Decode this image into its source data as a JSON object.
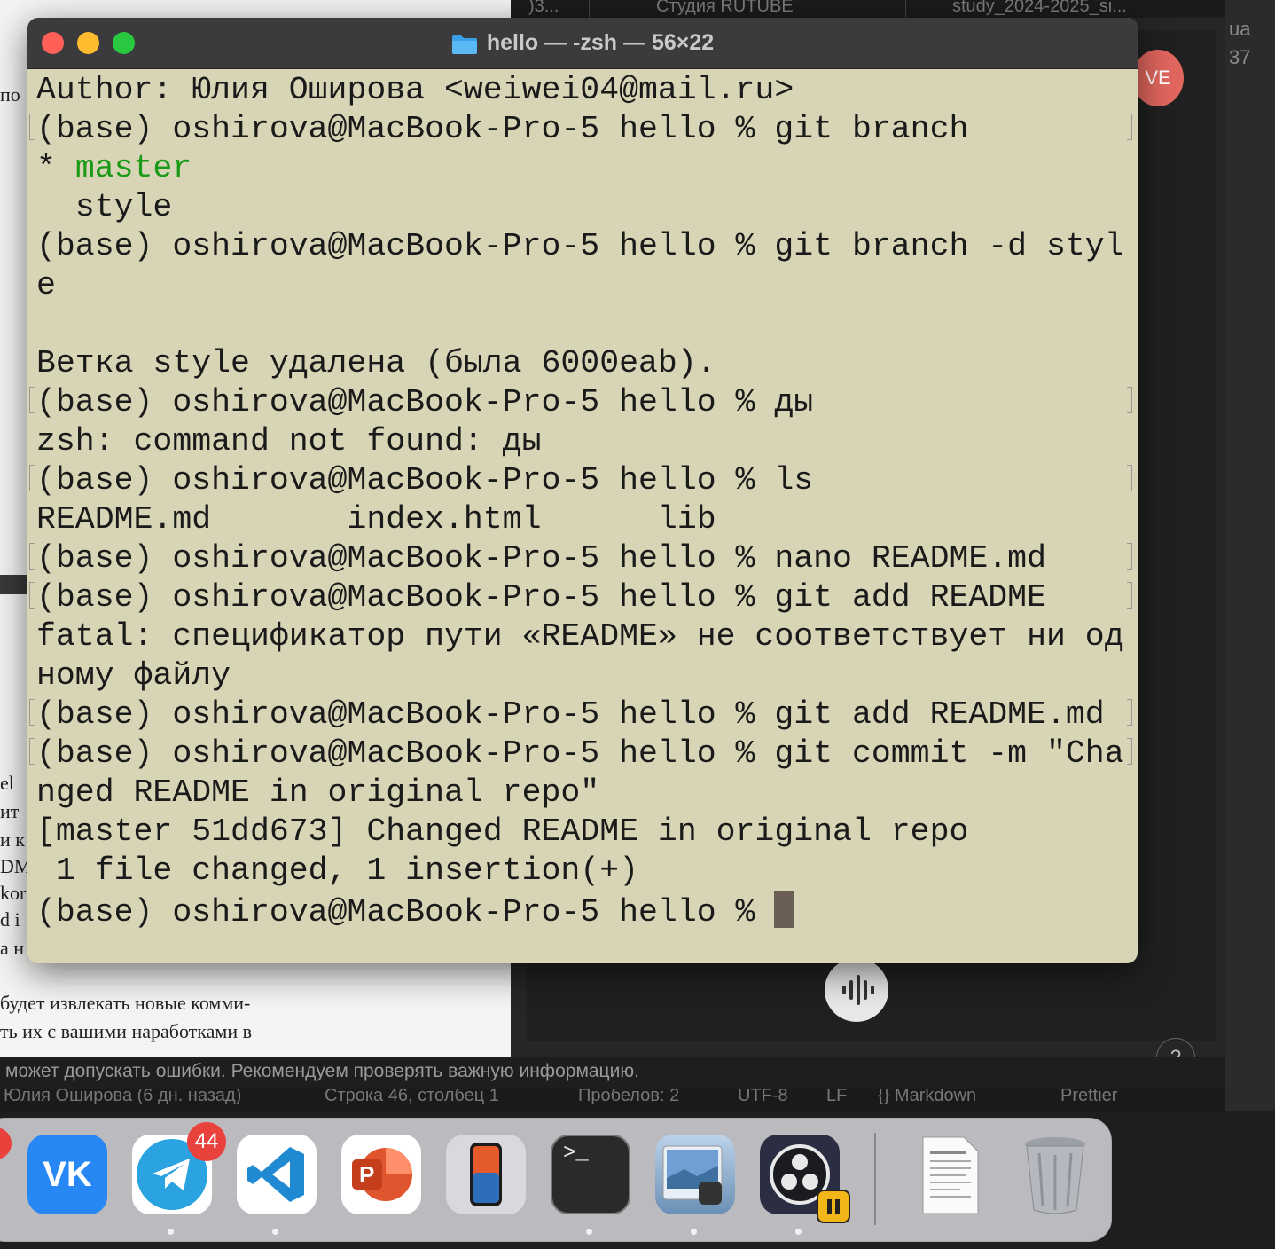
{
  "bg_doc": {
    "fragments": [
      "по",
      "el",
      "ит",
      "и к",
      "DM",
      "kor",
      "d i",
      "а н"
    ],
    "line1": "будет извлекать новые комми-",
    "line2": "ть их с вашими наработками в"
  },
  "bg_app": {
    "tabs": [
      ")3...",
      "Студия RUTUBE",
      "study_2024-2025_si..."
    ],
    "avatar": "VE",
    "help": "?",
    "disclaimer": "может допускать ошибки. Рекомендуем проверять важную информацию.",
    "status": [
      "Юлия Оширова (6 дн. назад)",
      "Строка 46, столбец 1",
      "Пробелов: 2",
      "UTF-8",
      "LF",
      "{} Markdown",
      "Prettier"
    ],
    "edge": [
      "ua",
      "37"
    ]
  },
  "terminal": {
    "title": "hello — -zsh — 56×22",
    "lines": [
      "Author: Юлия Оширова <weiwei04@mail.ru>",
      "(base) oshirova@MacBook-Pro-5 hello % git branch",
      "* ",
      "master",
      "  style",
      "(base) oshirova@MacBook-Pro-5 hello % git branch -d styl",
      "e",
      "Ветка style удалена (была 6000eab).",
      "(base) oshirova@MacBook-Pro-5 hello % ды",
      "zsh: command not found: ды",
      "(base) oshirova@MacBook-Pro-5 hello % ls",
      "README.md       index.html      lib",
      "(base) oshirova@MacBook-Pro-5 hello % nano README.md",
      "(base) oshirova@MacBook-Pro-5 hello % git add README",
      "fatal: спецификатор пути «README» не соответствует ни од",
      "ному файлу",
      "(base) oshirova@MacBook-Pro-5 hello % git add README.md",
      "(base) oshirova@MacBook-Pro-5 hello % git commit -m \"Cha",
      "nged README in original repo\"",
      "[master 51dd673] Changed README in original repo",
      " 1 file changed, 1 insertion(+)",
      "(base) oshirova@MacBook-Pro-5 hello % "
    ]
  },
  "dock": {
    "items": [
      {
        "name": "VK",
        "icon": "vk-icon"
      },
      {
        "name": "Telegram",
        "icon": "telegram-icon",
        "badge": "44"
      },
      {
        "name": "Visual Studio Code",
        "icon": "vscode-icon"
      },
      {
        "name": "PowerPoint",
        "icon": "powerpoint-icon"
      },
      {
        "name": "iPhone Mirroring",
        "icon": "iphone-icon"
      },
      {
        "name": "Terminal",
        "icon": "terminal-icon",
        "glyph": ">_"
      },
      {
        "name": "Preview",
        "icon": "preview-icon"
      },
      {
        "name": "OBS",
        "icon": "obs-icon"
      },
      {
        "name": "Document",
        "icon": "document-icon"
      },
      {
        "name": "Trash",
        "icon": "trash-icon"
      }
    ]
  }
}
